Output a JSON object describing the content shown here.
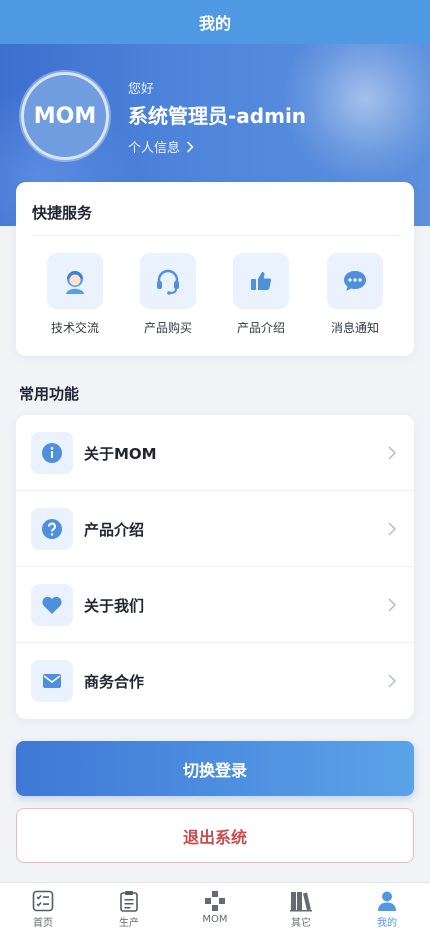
{
  "header": {
    "title": "我的"
  },
  "profile": {
    "avatar_text": "MOM",
    "greeting": "您好",
    "username": "系统管理员-admin",
    "info_link": "个人信息"
  },
  "quick_services": {
    "title": "快捷服务",
    "items": [
      {
        "label": "技术交流",
        "icon": "support-agent-icon"
      },
      {
        "label": "产品购买",
        "icon": "headset-icon"
      },
      {
        "label": "产品介绍",
        "icon": "thumbs-up-icon"
      },
      {
        "label": "消息通知",
        "icon": "chat-bubble-icon"
      }
    ]
  },
  "common_functions": {
    "title": "常用功能",
    "items": [
      {
        "label": "关于MOM",
        "icon": "info-icon"
      },
      {
        "label": "产品介绍",
        "icon": "help-icon"
      },
      {
        "label": "关于我们",
        "icon": "heart-icon"
      },
      {
        "label": "商务合作",
        "icon": "mail-icon"
      }
    ]
  },
  "actions": {
    "switch_login": "切换登录",
    "logout": "退出系统"
  },
  "tabbar": {
    "active_index": 4,
    "items": [
      {
        "label": "首页",
        "icon": "checklist-icon"
      },
      {
        "label": "生产",
        "icon": "clipboard-icon"
      },
      {
        "label": "MOM",
        "icon": "gamepad-icon"
      },
      {
        "label": "其它",
        "icon": "books-icon"
      },
      {
        "label": "我的",
        "icon": "person-icon"
      }
    ]
  },
  "colors": {
    "accent": "#4f99e2",
    "danger": "#cc4b4b",
    "icon_bg": "#e9f2fd"
  }
}
